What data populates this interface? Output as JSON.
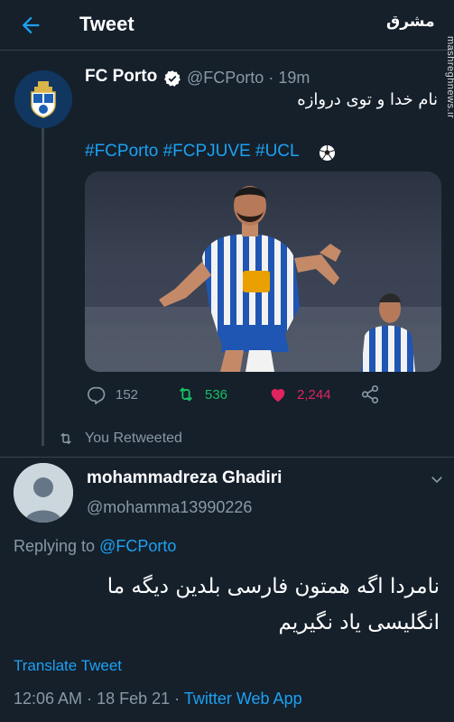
{
  "header": {
    "title": "Tweet",
    "watermark_logo": "مشرق",
    "watermark_url": "mashreghnews.ir"
  },
  "tweet": {
    "author_name": "FC Porto",
    "author_handle": "@FCPorto",
    "separator": "·",
    "time": "19m",
    "text": "نام خدا و توی دروازه",
    "hashtags": "#FCPorto #FCPJUVE #UCL",
    "stats": {
      "replies": "152",
      "retweets": "536",
      "likes": "2,244"
    }
  },
  "retweet_indicator": "You Retweeted",
  "reply": {
    "author_name": "mohammadreza Ghadiri",
    "author_handle": "@mohamma13990226",
    "replying_prefix": "Replying to",
    "replying_to": "@FCPorto",
    "text_line1": "نامردا اگه همتون فارسی بلدین دیگه ما",
    "text_line2": "انگلیسی یاد نگیریم",
    "translate_label": "Translate Tweet",
    "time": "12:06 AM",
    "separator": "·",
    "date": "18 Feb 21",
    "app": "Twitter Web App"
  },
  "colors": {
    "background": "#15202b",
    "accent": "#1da1f2",
    "retweet": "#17bf63",
    "like": "#e0245e",
    "muted": "#8899a6"
  },
  "icons": [
    "back-arrow-icon",
    "verified-icon",
    "soccer-ball-icon",
    "reply-icon",
    "retweet-icon",
    "heart-icon",
    "share-icon",
    "chevron-down-icon"
  ]
}
